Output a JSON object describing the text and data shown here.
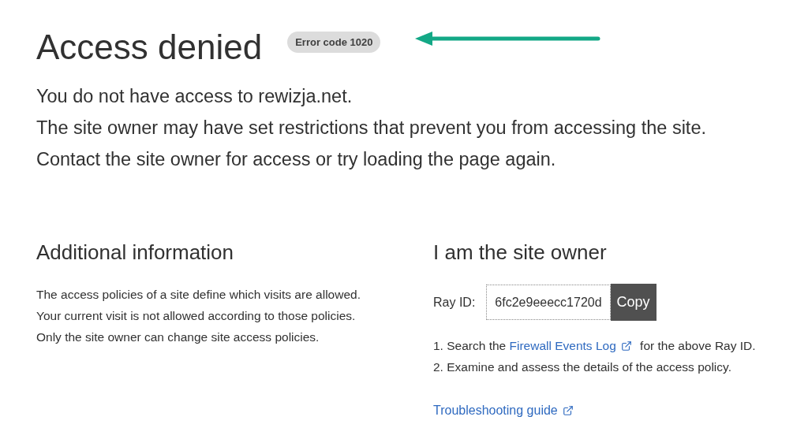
{
  "title": "Access denied",
  "error_badge": "Error code 1020",
  "annotation_arrow": {
    "color": "#13a886"
  },
  "message_lines": [
    "You do not have access to rewizja.net.",
    "The site owner may have set restrictions that prevent you from accessing the site.",
    "Contact the site owner for access or try loading the page again."
  ],
  "additional_info": {
    "heading": "Additional information",
    "lines": [
      "The access policies of a site define which visits are allowed.",
      "Your current visit is not allowed according to those policies.",
      "Only the site owner can change site access policies."
    ]
  },
  "site_owner": {
    "heading": "I am the site owner",
    "ray_label": "Ray ID:",
    "ray_id": "6fc2e9eeecc1720d",
    "copy_button": "Copy",
    "steps": [
      {
        "number": "1.",
        "before": "Search the",
        "link": "Firewall Events Log",
        "after": "for the above Ray ID."
      },
      {
        "number": "2.",
        "before": "Examine and assess the details of the access policy."
      }
    ],
    "guide_link": "Troubleshooting guide"
  }
}
